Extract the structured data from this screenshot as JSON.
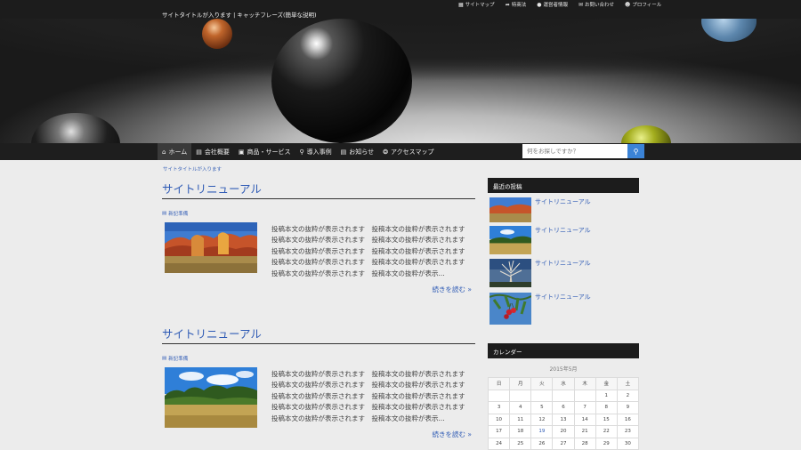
{
  "header": {
    "tagline": "サイトタイトルが入ります | キャッチフレーズ(簡単な説明)",
    "top_links": [
      {
        "icon": "sitemap-icon",
        "label": "サイトマップ"
      },
      {
        "icon": "pin-icon",
        "label": "特商法"
      },
      {
        "icon": "info-icon",
        "label": "運営者情報"
      },
      {
        "icon": "mail-icon",
        "label": "お問い合わせ"
      },
      {
        "icon": "user-icon",
        "label": "プロフィール"
      }
    ]
  },
  "nav": {
    "items": [
      {
        "icon": "home-icon",
        "label": "ホーム"
      },
      {
        "icon": "document-icon",
        "label": "会社概要"
      },
      {
        "icon": "cubes-icon",
        "label": "商品・サービス"
      },
      {
        "icon": "map-marker-icon",
        "label": "導入事例"
      },
      {
        "icon": "newspaper-icon",
        "label": "お知らせ"
      },
      {
        "icon": "compass-icon",
        "label": "アクセスマップ"
      }
    ],
    "search_placeholder": "何をお探しですか？"
  },
  "breadcrumb": "サイトタイトルが入ります",
  "posts": [
    {
      "title": "サイトリニューアル",
      "category": "新記準備",
      "excerpt_lines": [
        "投稿本文の抜粋が表示されます　投稿本文の抜粋が表示されます",
        "投稿本文の抜粋が表示されます　投稿本文の抜粋が表示されます",
        "投稿本文の抜粋が表示されます　投稿本文の抜粋が表示されます",
        "投稿本文の抜粋が表示されます　投稿本文の抜粋が表示されます",
        "投稿本文の抜粋が表示されます　投稿本文の抜粋が表示..."
      ],
      "read_more": "続きを読む »"
    },
    {
      "title": "サイトリニューアル",
      "category": "新記準備",
      "excerpt_lines": [
        "投稿本文の抜粋が表示されます　投稿本文の抜粋が表示されます",
        "投稿本文の抜粋が表示されます　投稿本文の抜粋が表示されます",
        "投稿本文の抜粋が表示されます　投稿本文の抜粋が表示されます",
        "投稿本文の抜粋が表示されます　投稿本文の抜粋が表示されます",
        "投稿本文の抜粋が表示されます　投稿本文の抜粋が表示..."
      ],
      "read_more": "続きを読む »"
    }
  ],
  "sidebar": {
    "recent_title": "最近の投稿",
    "recent_posts": [
      {
        "title": "サイトリニューアル"
      },
      {
        "title": "サイトリニューアル"
      },
      {
        "title": "サイトリニューアル"
      },
      {
        "title": "サイトリニューアル"
      }
    ],
    "calendar_title": "カレンダー",
    "calendar": {
      "caption": "2015年5月",
      "weekdays": [
        "日",
        "月",
        "火",
        "水",
        "木",
        "金",
        "土"
      ],
      "weeks": [
        [
          "",
          "",
          "",
          "",
          "",
          "1",
          "2"
        ],
        [
          "3",
          "4",
          "5",
          "6",
          "7",
          "8",
          "9"
        ],
        [
          "10",
          "11",
          "12",
          "13",
          "14",
          "15",
          "16"
        ],
        [
          "17",
          "18",
          "19",
          "20",
          "21",
          "22",
          "23"
        ],
        [
          "24",
          "25",
          "26",
          "27",
          "28",
          "29",
          "30"
        ]
      ],
      "highlight": "19"
    }
  },
  "colors": {
    "link": "#2f5bb5",
    "dark_bar": "#1c1c1c",
    "search_button": "#3b83d6"
  }
}
